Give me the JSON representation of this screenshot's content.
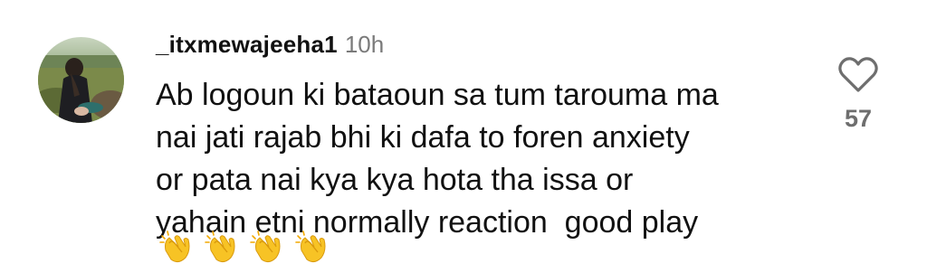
{
  "comment": {
    "username": "_itxmewajeeha1",
    "timestamp": "10h",
    "text_lines": [
      "Ab logoun ki bataoun sa tum tarouma ma",
      "nai jati rajab bhi ki dafa to foren anxiety",
      "or pata nai kya kya hota tha issa or",
      "yahain etni normally reaction  good play"
    ],
    "emojis": [
      "👏",
      "👏",
      "👏",
      "👏"
    ],
    "like_count": "57"
  },
  "icons": {
    "like": "heart-outline-icon",
    "reaction": "clapping-hands-icon"
  },
  "colors": {
    "text": "#111111",
    "muted": "#7a7a7a",
    "background": "#ffffff"
  }
}
